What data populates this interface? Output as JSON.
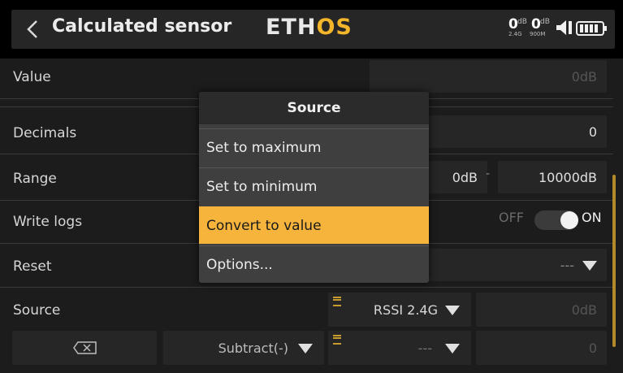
{
  "header": {
    "title": "Calculated sensor",
    "logo_part1": "ETH",
    "logo_part2": "OS",
    "rssi": {
      "val1": "0",
      "unit1": "dB",
      "band1": "2.4G",
      "val2": "0",
      "unit2": "dB",
      "band2": "900M"
    },
    "icons": [
      "back-chevron-icon",
      "speaker-icon",
      "battery-icon"
    ]
  },
  "rows": {
    "value": {
      "label": "Value",
      "field": "0dB"
    },
    "decimals": {
      "label": "Decimals",
      "field": "0"
    },
    "range": {
      "label": "Range",
      "min": "0dB",
      "separator": "-",
      "max": "10000dB"
    },
    "write_logs": {
      "label": "Write logs",
      "off_label": "OFF",
      "on_label": "ON",
      "state": "on"
    },
    "reset": {
      "label": "Reset",
      "value": "---"
    },
    "source": {
      "label": "Source",
      "value": "RSSI 2.4G",
      "field": "0dB"
    },
    "operation": {
      "icon": "clear-x-icon",
      "value": "Subtract(-)",
      "source": "---",
      "field": "0"
    }
  },
  "menu": {
    "title": "Source",
    "items": [
      "Set to maximum",
      "Set to minimum",
      "Convert to value",
      "Options..."
    ],
    "selected_index": 2
  },
  "colors": {
    "accent": "#f6b43c",
    "background": "#1c1c1c",
    "field": "#262626",
    "menu": "#3f3f3f"
  }
}
